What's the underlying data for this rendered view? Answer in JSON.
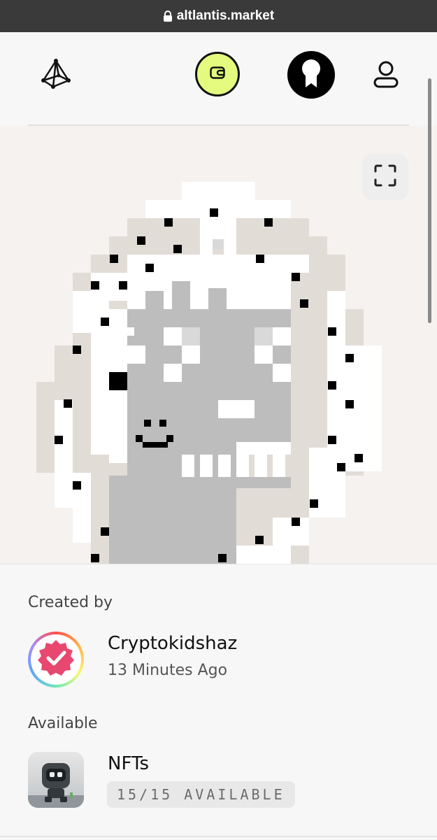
{
  "browser": {
    "url": "altlantis.market",
    "lock_icon": "lock-icon"
  },
  "header": {
    "logo_icon": "pyramid-logo-icon",
    "wallet_icon": "wallet-icon",
    "award_icon": "award-icon",
    "profile_icon": "user-icon",
    "accent_color": "#e4fa7f"
  },
  "artwork": {
    "expand_icon": "fullscreen-icon",
    "background": "#f5f2ef"
  },
  "creator": {
    "label": "Created by",
    "name": "Cryptokidshaz",
    "time": "13 Minutes Ago",
    "verified_icon": "verified-badge-icon"
  },
  "availability": {
    "label": "Available",
    "title": "NFTs",
    "count": "15/15 AVAILABLE"
  }
}
